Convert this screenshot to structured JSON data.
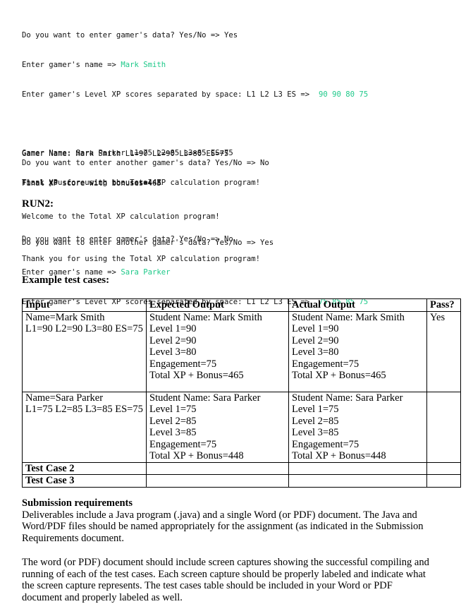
{
  "run1": {
    "lines": [
      {
        "prompt": "Do you want to enter gamer's data? Yes/No => ",
        "input": "Yes",
        "input_green": false
      },
      {
        "prompt": "Enter gamer's name => ",
        "input": "Mark Smith",
        "input_green": true
      },
      {
        "prompt": "Enter gamer's Level XP scores separated by space: L1 L2 L3 ES =>  ",
        "input": "90 90 80 75",
        "input_green": true
      },
      {
        "prompt": "",
        "input": ""
      },
      {
        "prompt": "Gamer Name: Mark Smith L1=90 L2=90 L3=80 ES=75",
        "input": ""
      },
      {
        "prompt": "Final XP score with bonuses=465",
        "input": ""
      },
      {
        "prompt": "",
        "input": ""
      },
      {
        "prompt": "Do you want to enter another gamer's data? Yes/No => ",
        "input": "Yes",
        "input_green": false
      },
      {
        "prompt": "Enter gamer's name => ",
        "input": "Sara Parker",
        "input_green": true
      },
      {
        "prompt": "Enter gamer's Level XP scores separated by space: L1 L2 L3 ES =>  ",
        "input": "75 85 85 75",
        "input_green": true
      }
    ],
    "gamer2_lines": [
      "Gamer Name: Sara Parker L1=75 L2=85 L3=85 ES=75",
      "Final XP score with bonuses=448"
    ],
    "another_prompt": "Do you want to enter another gamer's data? Yes/No => No",
    "thank_you": "Thank you for using the Total XP calculation program!"
  },
  "run2": {
    "heading": "RUN2:",
    "welcome": "Welcome to the Total XP calculation program!",
    "prompt": "Do you want to enter gamer's data? Yes/No => No",
    "thank_you": "Thank you for using the Total XP calculation program!"
  },
  "test_cases": {
    "heading": "Example test cases:",
    "columns": [
      "Input",
      "Expected Output",
      "Actual Output",
      "Pass?"
    ],
    "rows": [
      {
        "input": [
          "Name=Mark Smith",
          "L1=90 L2=90 L3=80 ES=75"
        ],
        "expected": [
          "Student Name: Mark Smith",
          "Level 1=90",
          "Level 2=90",
          "Level 3=80",
          "Engagement=75",
          "Total XP + Bonus=465"
        ],
        "actual": [
          "Student Name: Mark Smith",
          "Level 1=90",
          "Level 2=90",
          "Level 3=80",
          "Engagement=75",
          "Total XP + Bonus=465"
        ],
        "pass": "Yes"
      },
      {
        "input": [
          "Name=Sara Parker",
          "L1=75 L2=85 L3=85 ES=75"
        ],
        "expected": [
          "Student Name: Sara Parker",
          "Level 1=75",
          "Level 2=85",
          "Level 3=85",
          "Engagement=75",
          "Total XP + Bonus=448"
        ],
        "actual": [
          "Student Name: Sara Parker",
          "Level 1=75",
          "Level 2=85",
          "Level 3=85",
          "Engagement=75",
          "Total XP + Bonus=448"
        ],
        "pass": ""
      }
    ],
    "empty_rows": [
      "Test Case 2",
      "Test Case 3"
    ]
  },
  "submission": {
    "heading": "Submission requirements",
    "paragraph1": "Deliverables include a Java program (.java) and a single Word (or PDF) document. The Java and Word/PDF files should be named appropriately for the assignment (as indicated in the Submission Requirements document.",
    "paragraph2": "The word (or PDF) document should include screen captures showing the successful compiling and running of each of the test cases. Each screen capture should be properly labeled and indicate what the screen capture represents. The test cases table should be included in your Word or PDF document and properly labeled as well."
  }
}
